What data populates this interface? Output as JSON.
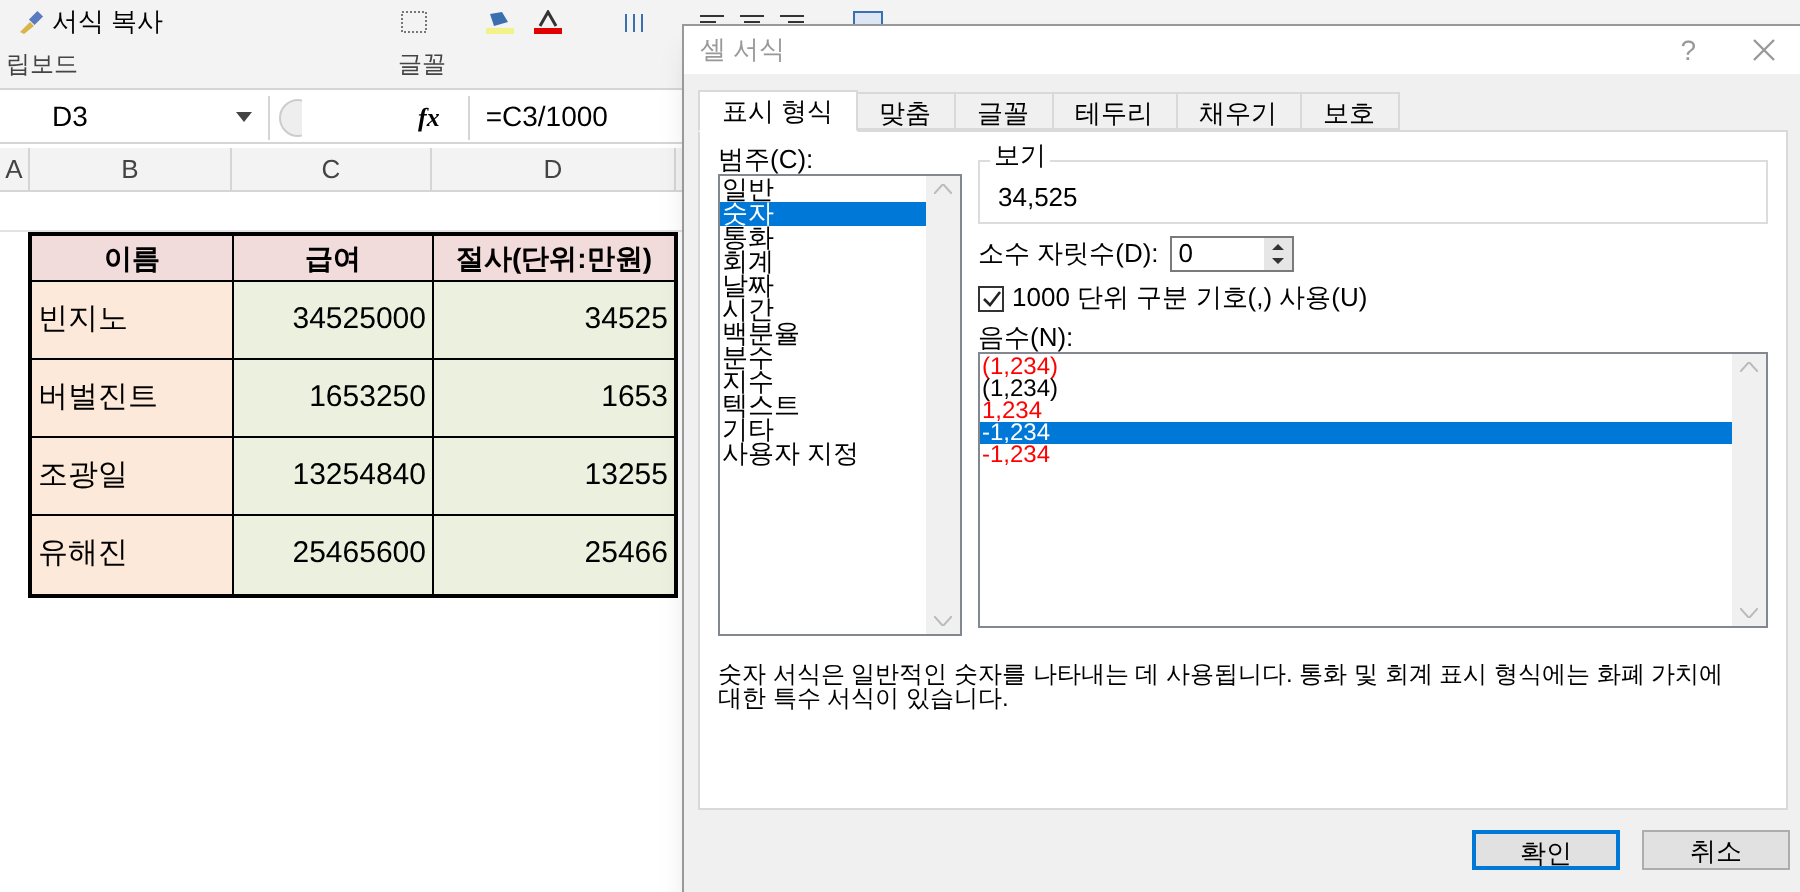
{
  "ribbon": {
    "format_painter": "서식 복사",
    "groups": [
      "립보드",
      "글꼴"
    ]
  },
  "formula_bar": {
    "name_box": "D3",
    "fx": "fx",
    "formula": "=C3/1000"
  },
  "columns": [
    "A",
    "B",
    "C",
    "D"
  ],
  "table": {
    "header": [
      "이름",
      "급여",
      "절사(단위:만원)"
    ],
    "rows": [
      [
        "빈지노",
        "34525000",
        "34525"
      ],
      [
        "버벌진트",
        "1653250",
        "1653"
      ],
      [
        "조광일",
        "13254840",
        "13255"
      ],
      [
        "유해진",
        "25465600",
        "25466"
      ]
    ]
  },
  "dialog": {
    "title": "셀 서식",
    "help": "?",
    "tabs": [
      {
        "label": "표시 형식",
        "selected": true
      },
      {
        "label": "맞춤",
        "selected": false
      },
      {
        "label": "글꼴",
        "selected": false
      },
      {
        "label": "테두리",
        "selected": false
      },
      {
        "label": "채우기",
        "selected": false
      },
      {
        "label": "보호",
        "selected": false
      }
    ],
    "category_label": "범주(C):",
    "categories": [
      {
        "label": "일반",
        "selected": false
      },
      {
        "label": "숫자",
        "selected": true
      },
      {
        "label": "통화",
        "selected": false
      },
      {
        "label": "회계",
        "selected": false
      },
      {
        "label": "날짜",
        "selected": false
      },
      {
        "label": "시간",
        "selected": false
      },
      {
        "label": "백분율",
        "selected": false
      },
      {
        "label": "분수",
        "selected": false
      },
      {
        "label": "지수",
        "selected": false
      },
      {
        "label": "텍스트",
        "selected": false
      },
      {
        "label": "기타",
        "selected": false
      },
      {
        "label": "사용자 지정",
        "selected": false
      }
    ],
    "preview_label": "보기",
    "preview_value": "34,525",
    "decimal_label": "소수 자릿수(D):",
    "decimal_value": "0",
    "thousands": {
      "label": "1000 단위 구분 기호(,) 사용(U)",
      "checked": true
    },
    "negative_label": "음수(N):",
    "negatives": [
      {
        "text": "(1,234)",
        "color": "#ff0000",
        "selected": false
      },
      {
        "text": "(1,234)",
        "color": "#000000",
        "selected": false
      },
      {
        "text": "1,234",
        "color": "#ff0000",
        "selected": false
      },
      {
        "text": "-1,234",
        "selected": true
      },
      {
        "text": "-1,234",
        "color": "#ff0000",
        "selected": false
      }
    ],
    "description": "숫자 서식은 일반적인 숫자를 나타내는 데 사용됩니다. 통화 및 회계 표시 형식에는 화폐 가치에 대한 특수 서식이 있습니다.",
    "buttons": [
      {
        "label": "확인",
        "default": true
      },
      {
        "label": "취소",
        "default": false
      }
    ]
  }
}
